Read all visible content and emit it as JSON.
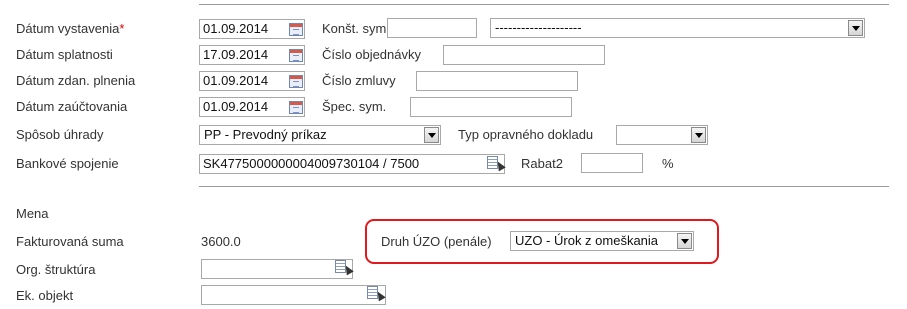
{
  "header": {
    "datum_vystavenia_label": "Dátum vystavenia",
    "datum_vystavenia_required": "*",
    "datum_vystavenia_value": "01.09.2014",
    "konst_sym_label": "Konšt. sym.",
    "konst_sym_value": "",
    "konst_sym_select": "--------------------",
    "datum_splatnosti_label": "Dátum splatnosti",
    "datum_splatnosti_value": "17.09.2014",
    "cislo_objednavky_label": "Číslo objednávky",
    "cislo_objednavky_value": "",
    "datum_zdan_label": "Dátum zdan. plnenia",
    "datum_zdan_value": "01.09.2014",
    "cislo_zmluvy_label": "Číslo zmluvy",
    "cislo_zmluvy_value": "",
    "datum_zauct_label": "Dátum zaúčtovania",
    "datum_zauct_value": "01.09.2014",
    "spec_sym_label": "Špec. sym.",
    "spec_sym_value": "",
    "sposob_uhrady_label": "Spôsob úhrady",
    "sposob_uhrady_value": "PP - Prevodný príkaz",
    "typ_opr_label": "Typ opravného dokladu",
    "typ_opr_value": "",
    "bank_label": "Bankové spojenie",
    "bank_value": "SK4775000000004009730104 / 7500",
    "rabat_label": "Rabat2",
    "rabat_value": "",
    "percent": "%"
  },
  "footer": {
    "mena_label": "Mena",
    "fakt_suma_label": "Fakturovaná suma",
    "fakt_suma_value": "3600.0",
    "druh_uzo_label": "Druh ÚZO (penále)",
    "druh_uzo_value": "UZO - Úrok z omeškania",
    "org_label": "Org. štruktúra",
    "org_value": "",
    "ek_label": "Ek. objekt",
    "ek_value": ""
  },
  "colors": {
    "highlight": "#e0191f",
    "required": "#dd0000"
  },
  "icons": [
    "calendar-icon",
    "lookup-icon",
    "dropdown-arrow-icon"
  ]
}
